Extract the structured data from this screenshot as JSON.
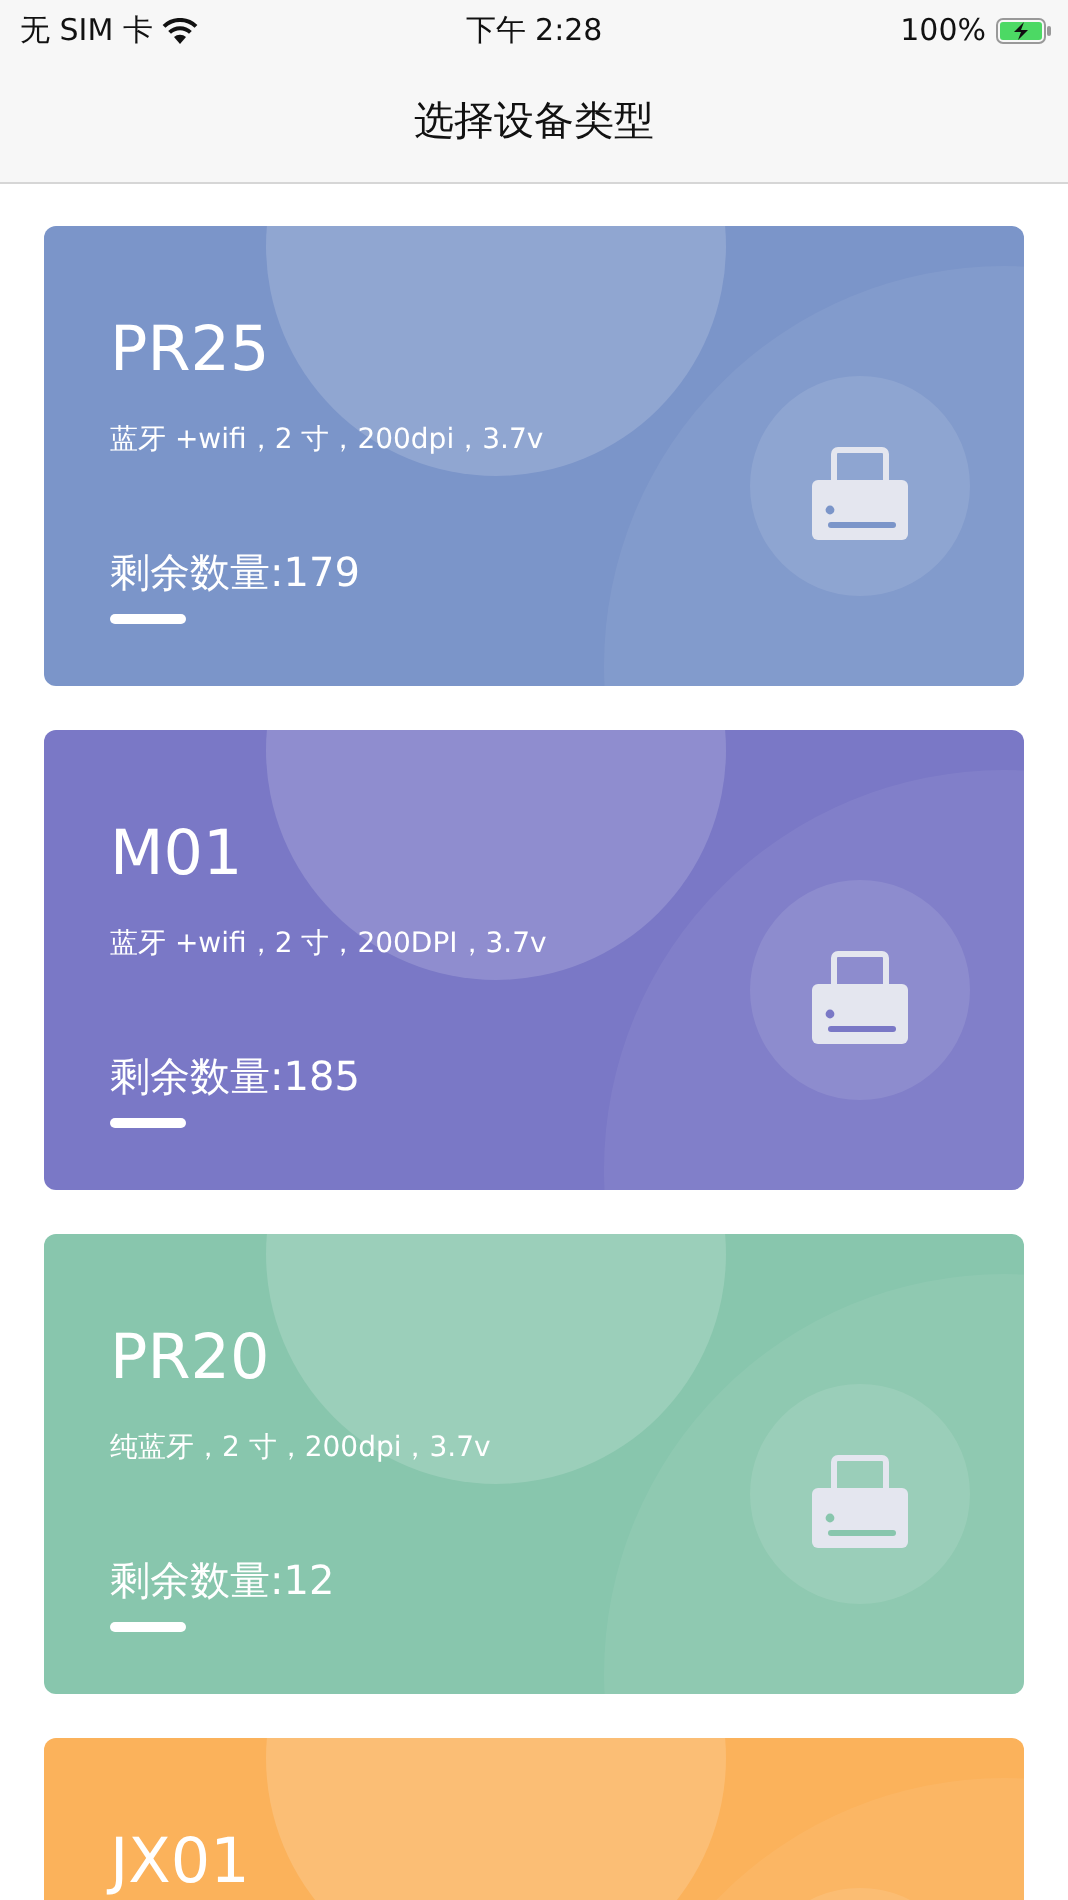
{
  "status_bar": {
    "carrier": "无 SIM 卡",
    "time": "下午 2:28",
    "battery": "100%"
  },
  "nav": {
    "title": "选择设备类型"
  },
  "devices": [
    {
      "name": "PR25",
      "specs": "蓝牙 +wifi，2 寸，200dpi，3.7v",
      "remaining": "剩余数量:179",
      "color": "#7b95c9"
    },
    {
      "name": "M01",
      "specs": "蓝牙 +wifi，2 寸，200DPI，3.7v",
      "remaining": "剩余数量:185",
      "color": "#7a78c6"
    },
    {
      "name": "PR20",
      "specs": "纯蓝牙，2 寸，200dpi，3.7v",
      "remaining": "剩余数量:12",
      "color": "#88c6ad"
    },
    {
      "name": "JX01",
      "color": "#fbb25b"
    }
  ]
}
